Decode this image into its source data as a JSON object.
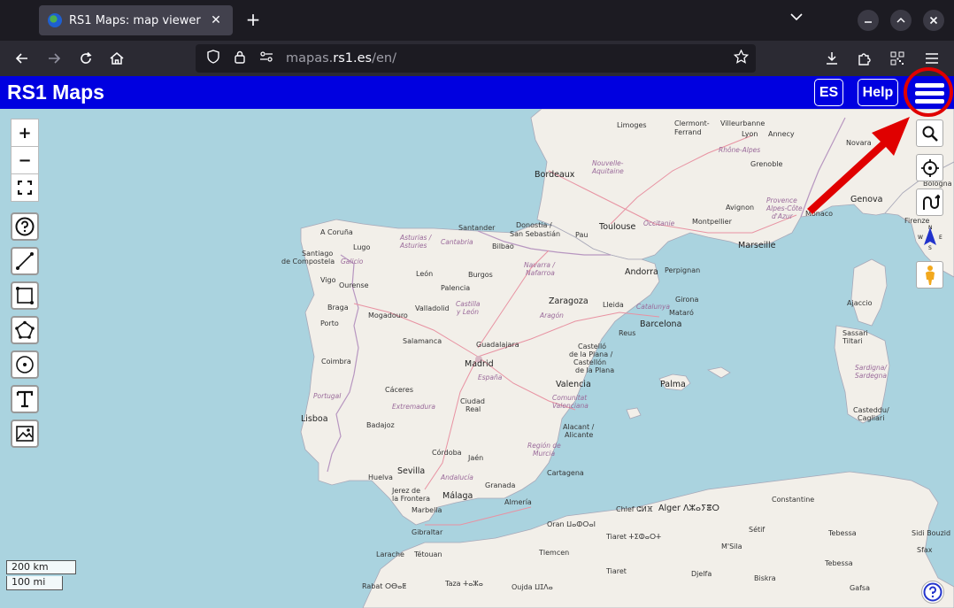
{
  "browser": {
    "tab_title": "RS1 Maps: map viewer",
    "tab_close": "✕",
    "new_tab": "+",
    "url_prefix": "mapas.",
    "url_domain": "rs1.es",
    "url_path": "/en/"
  },
  "app": {
    "title": "RS1 Maps",
    "lang_button": "ES",
    "help_button": "Help"
  },
  "map": {
    "zoom_in": "+",
    "zoom_out": "−",
    "scale_km": "200 km",
    "scale_mi": "100 mi",
    "cities": [
      {
        "name": "Limoges",
        "big": false
      },
      {
        "name": "Clermont-",
        "big": false
      },
      {
        "name": "Ferrand",
        "big": false
      },
      {
        "name": "Villeurbanne",
        "big": false
      },
      {
        "name": "Lyon",
        "big": false
      },
      {
        "name": "Rhône-Alpes",
        "big": false,
        "region": true
      },
      {
        "name": "Annecy",
        "big": false
      },
      {
        "name": "Grenoble",
        "big": false
      },
      {
        "name": "Novara",
        "big": false
      },
      {
        "name": "Bordeaux",
        "big": true
      },
      {
        "name": "Nouvelle-",
        "big": false,
        "region": true
      },
      {
        "name": "Aquitaine",
        "big": false,
        "region": true
      },
      {
        "name": "Toulouse",
        "big": true
      },
      {
        "name": "Occitanie",
        "big": false,
        "region": true
      },
      {
        "name": "Avignon",
        "big": false
      },
      {
        "name": "Montpellier",
        "big": false
      },
      {
        "name": "Provence",
        "big": false,
        "region": true
      },
      {
        "name": "Alpes-Côte",
        "big": false,
        "region": true
      },
      {
        "name": "d'Azur",
        "big": false,
        "region": true
      },
      {
        "name": "Monaco",
        "big": false
      },
      {
        "name": "Genova",
        "big": true
      },
      {
        "name": "Bologna",
        "big": false
      },
      {
        "name": "Firenze",
        "big": false
      },
      {
        "name": "Marseille",
        "big": true
      },
      {
        "name": "A Coruña",
        "big": false
      },
      {
        "name": "Santander",
        "big": false
      },
      {
        "name": "Donostia /",
        "big": false
      },
      {
        "name": "San Sebastián",
        "big": false
      },
      {
        "name": "Bilbao",
        "big": false
      },
      {
        "name": "Pau",
        "big": false
      },
      {
        "name": "Asturias /",
        "big": false,
        "region": true
      },
      {
        "name": "Asturies",
        "big": false,
        "region": true
      },
      {
        "name": "Cantabria",
        "big": false,
        "region": true
      },
      {
        "name": "Lugo",
        "big": false
      },
      {
        "name": "Santiago",
        "big": false
      },
      {
        "name": "de Compostela",
        "big": false
      },
      {
        "name": "Galicio",
        "big": false,
        "region": true
      },
      {
        "name": "León",
        "big": false
      },
      {
        "name": "Burgos",
        "big": false
      },
      {
        "name": "Navarra /",
        "big": false,
        "region": true
      },
      {
        "name": "Nafarroa",
        "big": false,
        "region": true
      },
      {
        "name": "Andorra",
        "big": true
      },
      {
        "name": "Perpignan",
        "big": false
      },
      {
        "name": "Girona",
        "big": false
      },
      {
        "name": "Vigo",
        "big": false
      },
      {
        "name": "Ourense",
        "big": false
      },
      {
        "name": "Palencia",
        "big": false
      },
      {
        "name": "Braga",
        "big": false
      },
      {
        "name": "Valladolid",
        "big": false
      },
      {
        "name": "Castilla",
        "big": false,
        "region": true
      },
      {
        "name": "y León",
        "big": false,
        "region": true
      },
      {
        "name": "Zaragoza",
        "big": true
      },
      {
        "name": "Lleida",
        "big": false
      },
      {
        "name": "Catalunya",
        "big": false,
        "region": true
      },
      {
        "name": "Mogadouro",
        "big": false
      },
      {
        "name": "Aragón",
        "big": false,
        "region": true
      },
      {
        "name": "Mataró",
        "big": false
      },
      {
        "name": "Porto",
        "big": false
      },
      {
        "name": "Reus",
        "big": false
      },
      {
        "name": "Barcelona",
        "big": true
      },
      {
        "name": "Salamanca",
        "big": false
      },
      {
        "name": "Guadalajara",
        "big": false
      },
      {
        "name": "Coimbra",
        "big": false
      },
      {
        "name": "Castelló",
        "big": false
      },
      {
        "name": "de la Plana /",
        "big": false
      },
      {
        "name": "Castellón",
        "big": false
      },
      {
        "name": "de la Plana",
        "big": false
      },
      {
        "name": "Madrid",
        "big": true
      },
      {
        "name": "España",
        "big": false,
        "region": true
      },
      {
        "name": "Palma",
        "big": true
      },
      {
        "name": "Ajaccio",
        "big": false
      },
      {
        "name": "Portugal",
        "big": true,
        "region": true
      },
      {
        "name": "Cáceres",
        "big": false
      },
      {
        "name": "Extremadura",
        "big": false,
        "region": true
      },
      {
        "name": "Ciudad",
        "big": false
      },
      {
        "name": "Real",
        "big": false
      },
      {
        "name": "Valencia",
        "big": true
      },
      {
        "name": "Comunitat",
        "big": false,
        "region": true
      },
      {
        "name": "Valenciana",
        "big": false,
        "region": true
      },
      {
        "name": "Sassari",
        "big": false
      },
      {
        "name": "Tiltari",
        "big": false
      },
      {
        "name": "Sardigna/",
        "big": false,
        "region": true
      },
      {
        "name": "Sardegna",
        "big": false,
        "region": true
      },
      {
        "name": "Lisboa",
        "big": true
      },
      {
        "name": "Badajoz",
        "big": false
      },
      {
        "name": "Alacant /",
        "big": false
      },
      {
        "name": "Alicante",
        "big": false
      },
      {
        "name": "Córdoba",
        "big": false
      },
      {
        "name": "Jaén",
        "big": false
      },
      {
        "name": "Región de",
        "big": false,
        "region": true
      },
      {
        "name": "Murcia",
        "big": false,
        "region": true
      },
      {
        "name": "Sevilla",
        "big": true
      },
      {
        "name": "Huelva",
        "big": false
      },
      {
        "name": "Andalucía",
        "big": false,
        "region": true
      },
      {
        "name": "Granada",
        "big": false
      },
      {
        "name": "Cartagena",
        "big": false
      },
      {
        "name": "Jerez de",
        "big": false
      },
      {
        "name": "la Frontera",
        "big": false
      },
      {
        "name": "Málaga",
        "big": true
      },
      {
        "name": "Almería",
        "big": false
      },
      {
        "name": "Casteddu/",
        "big": false
      },
      {
        "name": "Cagliari",
        "big": false
      },
      {
        "name": "Marbella",
        "big": false
      },
      {
        "name": "Gibraltar",
        "big": false
      },
      {
        "name": "Chlef ⵛⵍⴼ",
        "big": false
      },
      {
        "name": "Alger ⴷⵣⴰⵢⴻⵔ",
        "big": true
      },
      {
        "name": "Constantine",
        "big": false
      },
      {
        "name": "Oran ⵡⴰⵀⵔⴰⵏ",
        "big": false
      },
      {
        "name": "Tiaret ⵜⵉⵀⴰⵔⵜ",
        "big": false
      },
      {
        "name": "Sétif",
        "big": false
      },
      {
        "name": "Tebessa",
        "big": false
      },
      {
        "name": "Sidi Bouzid",
        "big": false
      },
      {
        "name": "Sfax",
        "big": false
      },
      {
        "name": "Larache",
        "big": false
      },
      {
        "name": "Tétouan",
        "big": false
      },
      {
        "name": "Tlemcen",
        "big": false
      },
      {
        "name": "M'Sila",
        "big": false
      },
      {
        "name": "Biskra",
        "big": false
      },
      {
        "name": "Tebessa",
        "big": false
      },
      {
        "name": "Rabat ⵔⴱⴰⵟ",
        "big": false
      },
      {
        "name": "Taza ⵜⴰⵣⴰ",
        "big": false
      },
      {
        "name": "Oujda ⵡⵊⴷⴰ",
        "big": false
      },
      {
        "name": "Tiaret",
        "big": false
      },
      {
        "name": "Djelfa",
        "big": false
      },
      {
        "name": "Gafsa",
        "big": false
      }
    ]
  }
}
